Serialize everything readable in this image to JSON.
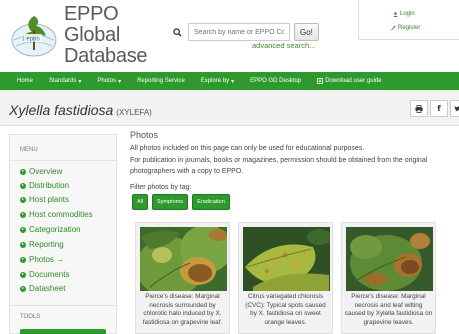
{
  "brand": {
    "line1": "EPPO",
    "line2": "Global",
    "line3": "Database",
    "logo_text": "eppo"
  },
  "search": {
    "placeholder": "Search by name or EPPO Code...",
    "go_label": "Go!",
    "advanced_label": "advanced search..."
  },
  "account": {
    "login_label": "Login",
    "register_label": "Register"
  },
  "nav": {
    "items": [
      {
        "label": "Home"
      },
      {
        "label": "Standards",
        "caret": "▾"
      },
      {
        "label": "Photos",
        "caret": "▾"
      },
      {
        "label": "Reporting Service"
      },
      {
        "label": "Explore by",
        "caret": "▾"
      },
      {
        "label": "EPPO GD Desktop"
      },
      {
        "label": "Download user guide",
        "icon": "download-icon"
      }
    ]
  },
  "title": {
    "species": "Xylella fastidiosa",
    "code": "(XYLEFA)"
  },
  "sidebar": {
    "menu_label": "MENU",
    "items": [
      {
        "label": "Overview"
      },
      {
        "label": "Distribution"
      },
      {
        "label": "Host plants"
      },
      {
        "label": "Host commodities"
      },
      {
        "label": "Categorization"
      },
      {
        "label": "Reporting"
      },
      {
        "label": "Photos →"
      },
      {
        "label": "Documents"
      },
      {
        "label": "Datasheet"
      }
    ],
    "tools_label": "TOOLS"
  },
  "main": {
    "heading": "Photos",
    "lines": [
      "All photos included on this page can only be used for educational purposes.",
      "For publication in journals, books or magazines, permission should be obtained from the original",
      "photographers with a copy to EPPO."
    ],
    "filter_label": "Filter photos by tag:",
    "tags": [
      {
        "label": "All"
      },
      {
        "label": "Symptoms"
      },
      {
        "label": "Eradication"
      }
    ],
    "photos": [
      {
        "caption": "Pierce's disease: Marginal necrosis surrounded by chlorotic halo induced by X. fastidiosa on grapevine leaf."
      },
      {
        "caption": "Citrus variegated chlorosis (CVC): Typical spots caused by X. fastidiosa on sweet orange leaves."
      },
      {
        "caption": "Pierce's disease: Marginal necrosis and leaf wilting caused by Xylella fastidiosa on grapevine leaves."
      }
    ]
  },
  "colors": {
    "brand_green": "#2e9a2e",
    "link_green": "#2e8b24"
  }
}
